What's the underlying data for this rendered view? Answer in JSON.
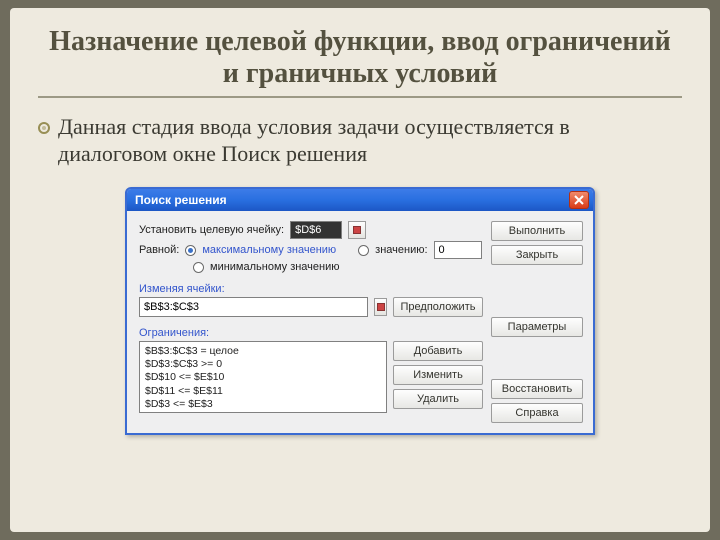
{
  "slide": {
    "title": "Назначение целевой функции, ввод ограничений и граничных условий",
    "bullet": "Данная стадия ввода условия задачи осуществляется в диалоговом окне Поиск решения"
  },
  "dialog": {
    "title": "Поиск решения",
    "target_label": "Установить целевую ячейку:",
    "target_value": "$D$6",
    "equal_label": "Равной:",
    "radio_max": "максимальному значению",
    "radio_val": "значению:",
    "radio_min": "минимальному значению",
    "value_field": "0",
    "changing_label": "Изменяя ячейки:",
    "changing_value": "$B$3:$C$3",
    "constraints_label": "Ограничения:",
    "constraints_text": "$B$3:$C$3 = целое\n$D$3:$C$3 >= 0\n$D$10 <= $E$10\n$D$11 <= $E$11\n$D$3 <= $E$3"
  },
  "buttons": {
    "run": "Выполнить",
    "close": "Закрыть",
    "guess": "Предположить",
    "params": "Параметры",
    "add": "Добавить",
    "change": "Изменить",
    "delete": "Удалить",
    "restore": "Восстановить",
    "help": "Справка"
  }
}
